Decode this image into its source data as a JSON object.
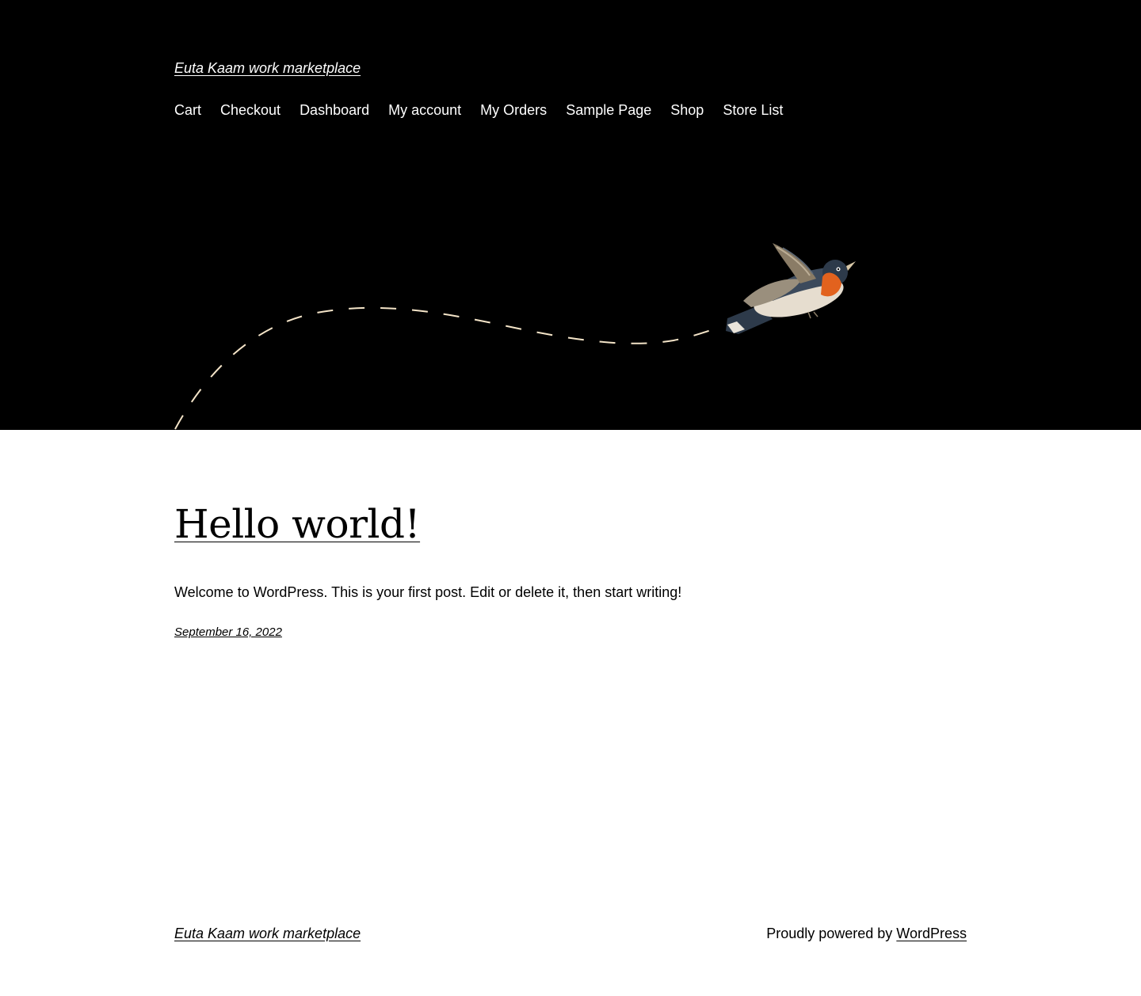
{
  "header": {
    "site_title": "Euta Kaam work marketplace",
    "nav": [
      "Cart",
      "Checkout",
      "Dashboard",
      "My account",
      "My Orders",
      "Sample Page",
      "Shop",
      "Store List"
    ]
  },
  "hero": {
    "background": "#000000",
    "path_color": "#f4e4c8",
    "illustration": "flying-bird-icon"
  },
  "post": {
    "title": "Hello world!",
    "excerpt": "Welcome to WordPress. This is your first post. Edit or delete it, then start writing!",
    "date": "September 16, 2022"
  },
  "footer": {
    "site_title": "Euta Kaam work marketplace",
    "credit_prefix": "Proudly powered by ",
    "credit_link": "WordPress"
  }
}
